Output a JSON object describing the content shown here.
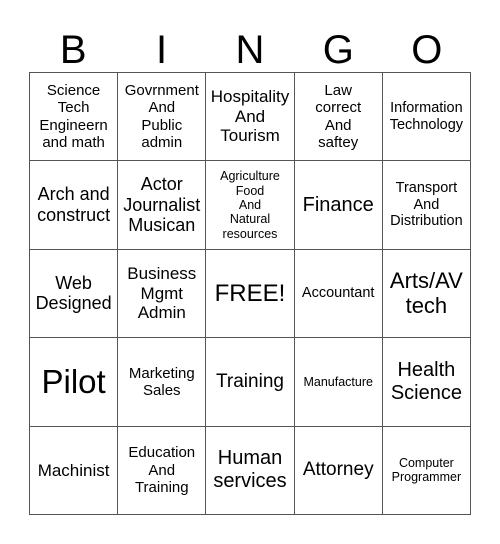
{
  "card": {
    "header": [
      "B",
      "I",
      "N",
      "G",
      "O"
    ],
    "rows": [
      [
        "Science\nTech\nEngineern\nand math",
        "Govrnment\nAnd\nPublic\nadmin",
        "Hospitality\nAnd\nTourism",
        "Law\ncorrect\nAnd\nsaftey",
        "Information\nTechnology"
      ],
      [
        "Arch and\nconstruct",
        "Actor\nJournalist\nMusican",
        "Agriculture\nFood\nAnd\nNatural\nresources",
        "Finance",
        "Transport\nAnd\nDistribution"
      ],
      [
        "Web\nDesigned",
        "Business\nMgmt\nAdmin",
        "FREE!",
        "Accountant",
        "Arts/AV\ntech"
      ],
      [
        "Pilot",
        "Marketing\nSales",
        "Training",
        "Manufacture",
        "Health\nScience"
      ],
      [
        "Machinist",
        "Education\nAnd\nTraining",
        "Human\nservices",
        "Attorney",
        "Computer\nProgrammer"
      ]
    ]
  }
}
